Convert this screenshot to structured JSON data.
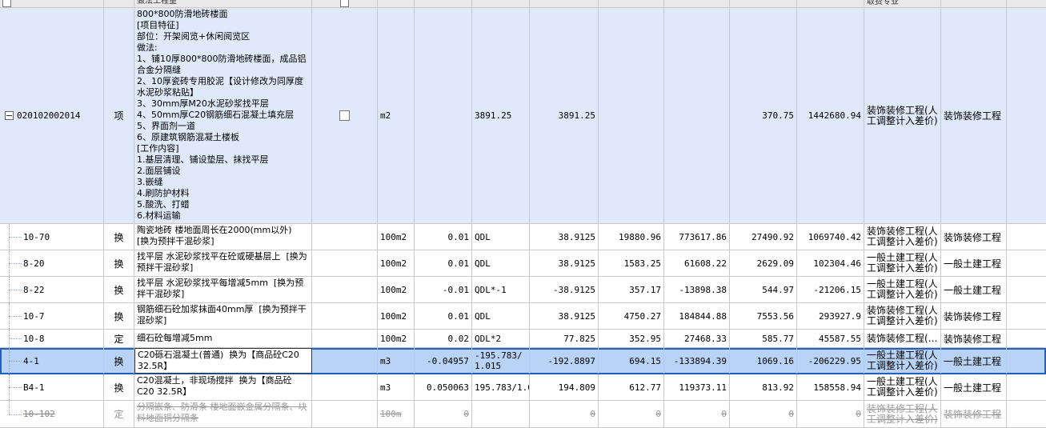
{
  "header": {
    "name_col": "做法工程量",
    "right_col": "取费专业"
  },
  "parent": {
    "code": "020102002014",
    "type": "项",
    "name": "800*800防滑地砖楼面\n[项目特征]\n部位：开架阅览+休闲阅览区\n做法:\n1、铺10厚800*800防滑地砖楼面，成品铝合金分隔缝\n2、10厚瓷砖专用胶泥【设计修改为同厚度水泥砂浆粘贴】\n3、30mm厚M20水泥砂浆找平层\n4、50mm厚C20钢筋细石混凝土填充层\n5、界面剂一道\n6、原建筑钢筋混凝土楼板\n[工作内容]\n1.基层清理、铺设垫层、抹找平层\n2.面层铺设\n3.嵌缝\n4.刷防护材料\n5.酸洗、打蜡\n6.材料运输",
    "unit": "m2",
    "qty_expr": "3891.25",
    "qty": "3891.25",
    "zh_price": "370.75",
    "zh_total": "1442680.94",
    "category": "装饰装修工程(人工调整计入差价)",
    "category2": "装饰装修工程"
  },
  "rows": [
    {
      "code": "10-70",
      "type": "换",
      "name": "陶瓷地砖 楼地面周长在2000(mm以外)  [换为预拌干混砂浆]",
      "unit": "100m2",
      "qexp": "0.01",
      "qexp2": "QDL",
      "qty": "38.9125",
      "up": "19880.96",
      "tot": "773617.86",
      "zh": "27490.92",
      "zhp": "1069740.42",
      "cat": "装饰装修工程(人工调整计入差价)",
      "cat2": "装饰装修工程"
    },
    {
      "code": "8-20",
      "type": "换",
      "name": "找平层 水泥砂浆找平在砼或硬基层上  [换为预拌干混砂浆]",
      "unit": "100m2",
      "qexp": "0.01",
      "qexp2": "QDL",
      "qty": "38.9125",
      "up": "1583.25",
      "tot": "61608.22",
      "zh": "2629.09",
      "zhp": "102304.46",
      "cat": "一般土建工程(人工调整计入差价)",
      "cat2": "一般土建工程"
    },
    {
      "code": "8-22",
      "type": "换",
      "name": "找平层 水泥砂浆找平每增减5mm  [换为预拌干混砂浆]",
      "unit": "100m2",
      "qexp": "-0.01",
      "qexp2": "QDL*-1",
      "qty": "-38.9125",
      "up": "357.17",
      "tot": "-13898.38",
      "zh": "544.97",
      "zhp": "-21206.15",
      "cat": "一般土建工程(人工调整计入差价)",
      "cat2": "一般土建工程"
    },
    {
      "code": "10-7",
      "type": "换",
      "name": "钢筋细石砼加浆抹面40mm厚  [换为预拌干混砂浆]",
      "unit": "100m2",
      "qexp": "0.01",
      "qexp2": "QDL",
      "qty": "38.9125",
      "up": "4750.27",
      "tot": "184844.88",
      "zh": "7553.56",
      "zhp": "293927.9",
      "cat": "装饰装修工程(人工调整计入差价)",
      "cat2": "装饰装修工程"
    },
    {
      "code": "10-8",
      "type": "定",
      "name": "细石砼每增减5mm",
      "unit": "100m2",
      "qexp": "0.02",
      "qexp2": "QDL*2",
      "qty": "77.825",
      "up": "352.95",
      "tot": "27468.33",
      "zh": "585.77",
      "zhp": "45587.55",
      "cat": "装饰装修工程(…",
      "cat2": "装饰装修工程"
    },
    {
      "code": "4-1",
      "type": "换",
      "name": "C20砾石混凝土(普通)  换为【商品砼C20 32.5R】",
      "unit": "m3",
      "qexp": "-0.04957",
      "qexp2": "-195.783/1.015",
      "qty": "-192.8897",
      "up": "694.15",
      "tot": "-133894.39",
      "zh": "1069.16",
      "zhp": "-206229.95",
      "cat": "一般土建工程(人工调整计入差价)",
      "cat2": "一般土建工程"
    },
    {
      "code": "B4-1",
      "type": "换",
      "name": "C20混凝土，非现场搅拌  换为【商品砼C20 32.5R】",
      "unit": "m3",
      "qexp": "0.050063",
      "qexp2": "195.783/1.005",
      "qty": "194.809",
      "up": "612.77",
      "tot": "119373.11",
      "zh": "813.92",
      "zhp": "158558.94",
      "cat": "一般土建工程(人工调整计入差价)",
      "cat2": "一般土建工程"
    },
    {
      "code": "10-102",
      "type": "定",
      "name": "分隔嵌条、防滑条 楼地面嵌金属分隔条、块料地面铜分隔条",
      "unit": "100m",
      "qexp": "0",
      "qexp2": "",
      "qty": "0",
      "up": "0",
      "tot": "0",
      "zh": "0",
      "zhp": "0",
      "cat": "装饰装修工程(人工调整计入差价)",
      "cat2": "装饰装修工程"
    }
  ]
}
